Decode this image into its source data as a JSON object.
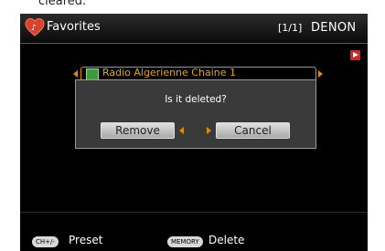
{
  "page_fragment": "cleared.",
  "header": {
    "title": "Favorites",
    "page_indicator": "[1/1]",
    "brand": "DENON"
  },
  "list": {
    "items": [
      {
        "label": "Radio Algerienne Chaine 1"
      }
    ]
  },
  "dialog": {
    "message": "Is it deleted?",
    "buttons": {
      "remove": "Remove",
      "cancel": "Cancel"
    }
  },
  "footer": {
    "key1": "CH+/-",
    "action1": "Preset",
    "key2": "MEMORY",
    "action2": "Delete"
  },
  "colors": {
    "accent": "#e28a00",
    "station_text": "#e6a800",
    "play_badge": "#e02020",
    "background": "#000000"
  }
}
